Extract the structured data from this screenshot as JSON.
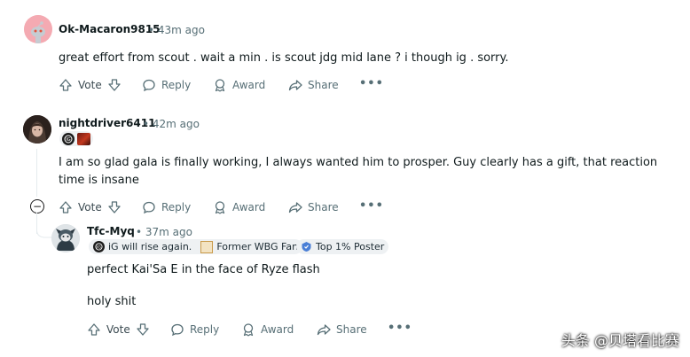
{
  "comments": [
    {
      "username": "Ok-Macaron9815",
      "time": "• 43m ago",
      "body": "great effort from scout . wait a min . is scout jdg mid lane ? i though ig . sorry.",
      "actions": {
        "vote": "Vote",
        "reply": "Reply",
        "award": "Award",
        "share": "Share",
        "more": "•••"
      }
    },
    {
      "username": "nightdriver6411",
      "time": "• 42m ago",
      "body": "I am so glad gala is finally working, I always wanted him to prosper. Guy clearly has a gift, that reaction time is insane",
      "actions": {
        "vote": "Vote",
        "reply": "Reply",
        "award": "Award",
        "share": "Share",
        "more": "•••"
      }
    },
    {
      "username": "Tfc-Myq",
      "time": "• 37m ago",
      "flair1": "iG will rise again.",
      "flair2": "Former WBG Fan",
      "flair3": "Top 1% Poster",
      "body_line1": "perfect Kai'Sa E in the face of Ryze flash",
      "body_line2": "holy shit",
      "actions": {
        "vote": "Vote",
        "reply": "Reply",
        "award": "Award",
        "share": "Share",
        "more": "•••"
      }
    }
  ],
  "collapse_symbol": "−",
  "watermark": "头条 @贝塔看比赛",
  "colors": {
    "reddit_orange": "#ff4500",
    "avatar_pink": "#f3a0a8",
    "meta_gray": "#576f76"
  }
}
